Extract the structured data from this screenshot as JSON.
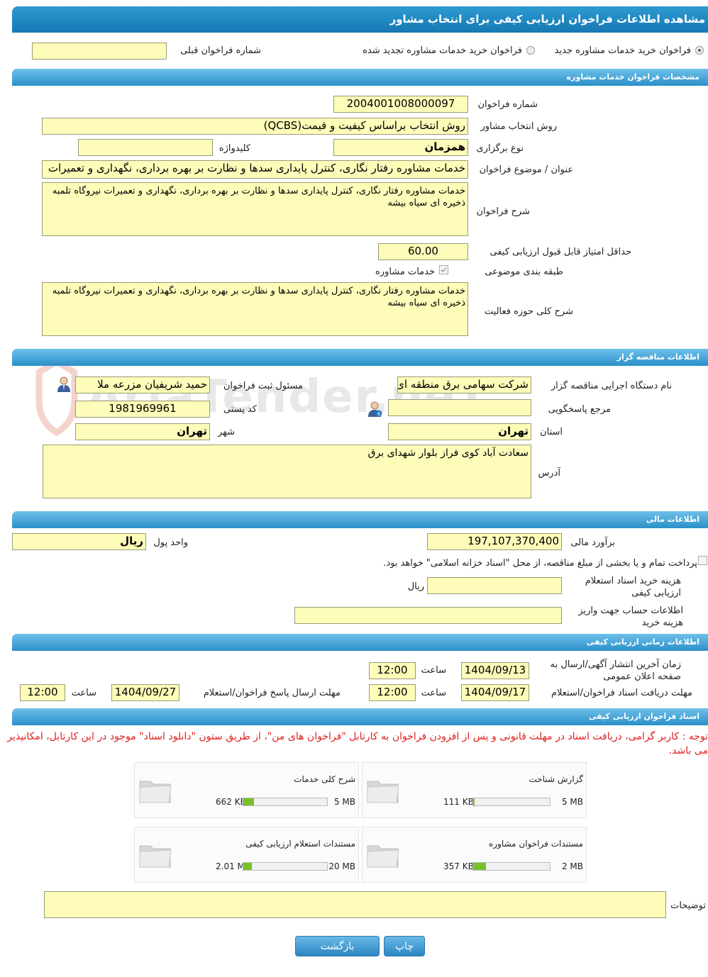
{
  "title": "مشاهده اطلاعات فراخوان ارزیابی کیفی برای انتخاب مشاور",
  "top": {
    "radio1": "فراخوان خرید خدمات مشاوره جدید",
    "radio2": "فراخوان خرید خدمات مشاوره تجدید شده",
    "prev_label": "شماره فراخوان قبلی",
    "prev_value": ""
  },
  "sections": {
    "specs": "مشخصات فراخوان خدمات مشاوره",
    "tenderer": "اطلاعات مناقصه گزار",
    "financial": "اطلاعات مالی",
    "timing": "اطلاعات زمانی ارزیابی کیفی",
    "docs": "اسناد فراخوان ارزیابی کیفی"
  },
  "specs": {
    "number_label": "شماره فراخوان",
    "number_value": "2004001008000097",
    "method_label": "روش انتخاب مشاور",
    "method_value": "روش انتخاب براساس کیفیت و قیمت(QCBS)",
    "type_label": "نوع برگزاری",
    "type_value": "همزمان",
    "keyword_label": "کلیدواژه",
    "keyword_value": "",
    "subject_label": "عنوان / موضوع فراخوان",
    "subject_value": "خدمات مشاوره رفتار نگاری، کنترل پایداری سدها و نظارت بر بهره برداری، نگهداری و تعمیرات",
    "desc_label": "شرح فراخوان",
    "desc_value": "خدمات مشاوره رفتار نگاری، کنترل پایداری سدها و نظارت بر بهره برداری، نگهداری و تعمیرات نیروگاه تلمبه ذخیره ای سیاه بیشه",
    "minscore_label": "حداقل امتیاز قابل قبول ارزیابی کیفی",
    "minscore_value": "60.00",
    "category_label": "طبقه بندی موضوعی",
    "category_value": "خدمات مشاوره",
    "scope_label": "شرح کلی حوزه فعالیت",
    "scope_value": "خدمات مشاوره رفتار نگاری، کنترل پایداری سدها و نظارت بر بهره برداری، نگهداری و تعمیرات نیروگاه تلمبه ذخیره ای سیاه بیشه"
  },
  "tenderer": {
    "org_label": "نام دستگاه اجرایی مناقصه گزار",
    "org_value": "شرکت سهامی برق منطقه ای تهران",
    "resp_label": "مسئول ثبت فراخوان",
    "resp_value": "حمید شریفیان مزرعه ملا",
    "ref_label": "مرجع پاسخگویی",
    "ref_value": "",
    "postal_label": "کد پستی",
    "postal_value": "1981969961",
    "province_label": "استان",
    "province_value": "تهران",
    "city_label": "شهر",
    "city_value": "تهران",
    "address_label": "آدرس",
    "address_value": "سعادت آباد کوی فراز بلوار شهدای برق"
  },
  "financial": {
    "estimate_label": "برآورد مالی",
    "estimate_value": "197,107,370,400",
    "currency_label": "واحد پول",
    "currency_value": "ریال",
    "treasury_text": "پرداخت تمام و یا بخشی از مبلغ مناقصه، از محل \"اسناد خزانه اسلامی\" خواهد بود.",
    "cost_label": "هزینه خرید اسناد استعلام ارزیابی کیفی",
    "cost_value": "",
    "cost_unit": "ریال",
    "account_label": "اطلاعات حساب جهت واریز هزینه خرید",
    "account_value": ""
  },
  "timing": {
    "publish_label": "زمان آخرین انتشار آگهی/ارسال به صفحه اعلان عمومی",
    "publish_date": "1404/09/13",
    "publish_time": "12:00",
    "time_label": "ساعت",
    "receive_label": "مهلت دریافت اسناد فراخوان/استعلام",
    "receive_date": "1404/09/17",
    "receive_time": "12:00",
    "send_label": "مهلت ارسال پاسخ فراخوان/استعلام",
    "send_date": "1404/09/27",
    "send_time": "12:00"
  },
  "docs": {
    "notice": "توجه : کاربر گرامی، دریافت اسناد در مهلت قانونی و پس از افزودن فراخوان به کارتابل \"فراخوان های من\"، از طریق ستون \"دانلود اسناد\" موجود در این کارتابل، امکانپذیر می باشد.",
    "files": [
      {
        "name": "گزارش شناخت",
        "size": "111 KB",
        "max": "5 MB",
        "fill": 0.02
      },
      {
        "name": "شرح کلی خدمات",
        "size": "662 KB",
        "max": "5 MB",
        "fill": 0.13
      },
      {
        "name": "مستندات فراخوان مشاوره",
        "size": "357 KB",
        "max": "2 MB",
        "fill": 0.17
      },
      {
        "name": "مستندات استعلام ارزیابی کیفی",
        "size": "2.01 MB",
        "max": "20 MB",
        "fill": 0.1
      }
    ],
    "desc_label": "توضیحات",
    "desc_value": ""
  },
  "buttons": {
    "print": "چاپ",
    "back": "بازگشت"
  },
  "watermark": "AriaTender.neT"
}
